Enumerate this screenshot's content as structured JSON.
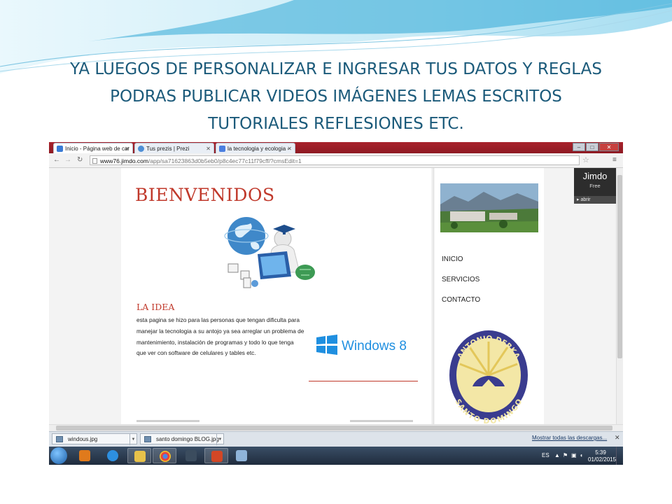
{
  "slide": {
    "title": "YA LUEGOS DE PERSONALIZAR E INGRESAR TUS DATOS Y REGLAS\nPODRAS PUBLICAR VIDEOS IMÁGENES LEMAS ESCRITOS\nTUTORIALES REFLESIONES ETC."
  },
  "browser": {
    "tabs": [
      {
        "label": "Inicio - Página web de car",
        "active": true
      },
      {
        "label": "Tus prezis | Prezi",
        "active": false
      },
      {
        "label": "la tecnologia y ecologia -",
        "active": false
      }
    ],
    "tab_close": "✕",
    "url_host": "www76.jimdo.com",
    "url_path": "/app/sa71623863d0b5eb0/p8c4ec77c11f79cff/?cmsEdit=1"
  },
  "page": {
    "heading": "BIENVENIDOS",
    "section_title": "LA IDEA",
    "paragraph": "esta pagina se hizo para las personas que tengan dificulta para manejar la tecnologia a su antojo ya sea arreglar un problema de mantenimiento, instalación de programas y todo lo que tenga que ver con software de celulares y tables etc.",
    "windows_logo_text": "Windows 8",
    "nav": [
      "INICIO",
      "SERVICIOS",
      "CONTACTO"
    ],
    "seal_top": "ANTONIO DERKA",
    "seal_bottom": "SANTO DOMINGO"
  },
  "jimdo": {
    "brand": "Jimdo",
    "plan": "Free",
    "open_label": "▸ abrir"
  },
  "downloads": {
    "items": [
      "windous.jpg",
      "santo domingo BLOG.jpg"
    ],
    "show_all": "Mostrar todas las descargas...",
    "close": "✕"
  },
  "taskbar": {
    "language": "ES",
    "time": "5:39",
    "date": "01/02/2015"
  },
  "colors": {
    "title_text": "#1b5a7a",
    "accent_red": "#c0392b",
    "browser_frame": "#a8222c"
  }
}
